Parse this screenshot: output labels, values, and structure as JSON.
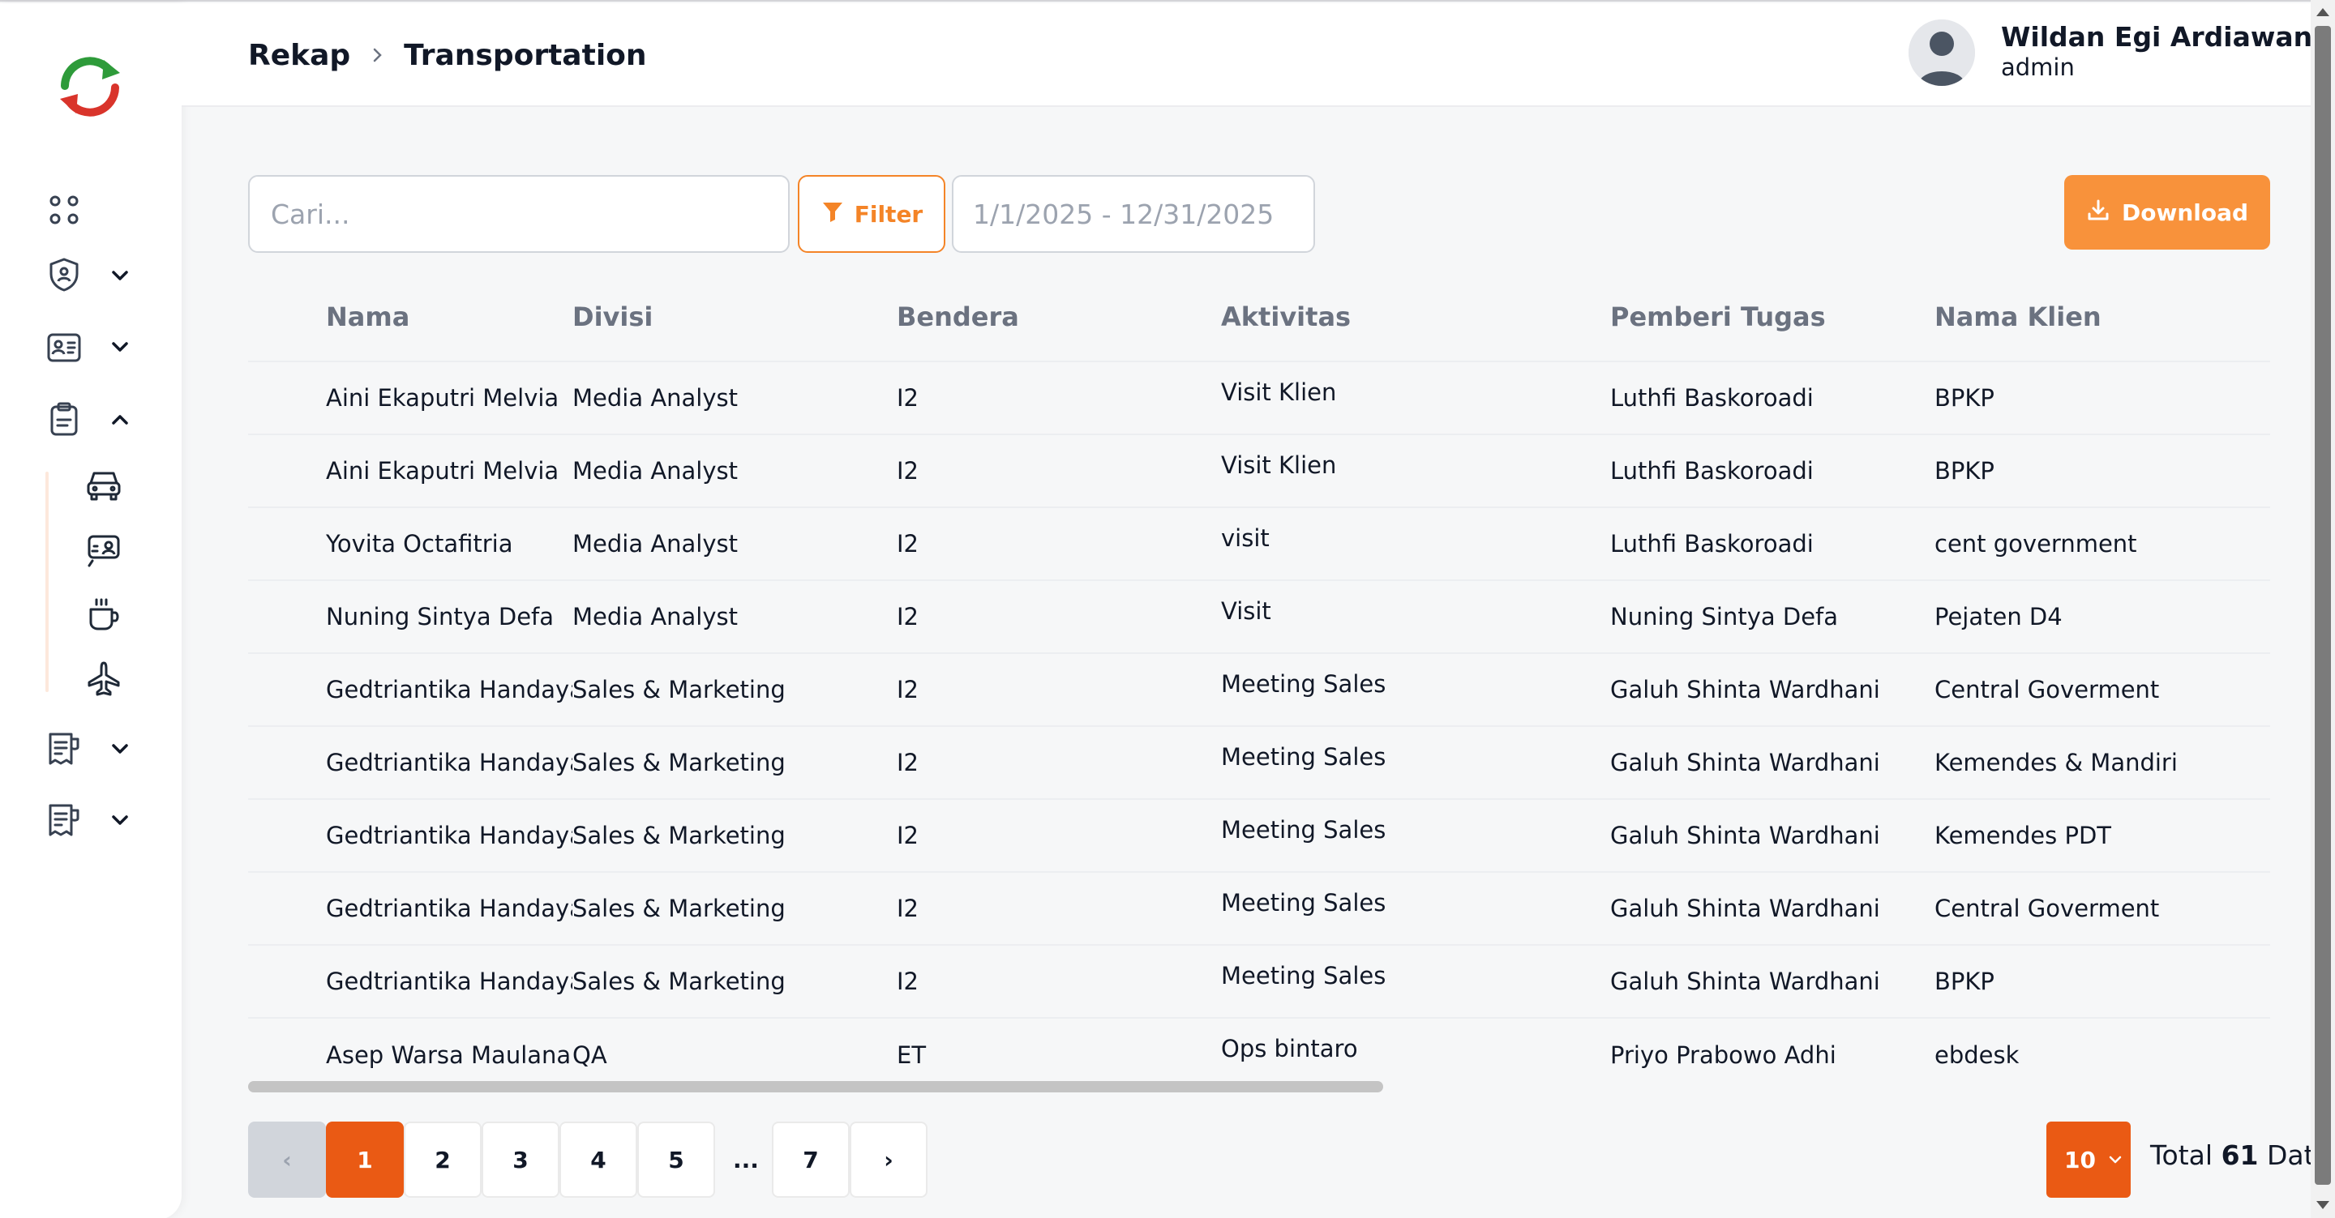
{
  "breadcrumb": {
    "parent": "Rekap",
    "current": "Transportation"
  },
  "user": {
    "name": "Wildan Egi Ardiawan",
    "role": "admin"
  },
  "toolbar": {
    "search_placeholder": "Cari...",
    "filter_label": "Filter",
    "date_range": "1/1/2025 - 12/31/2025",
    "download_label": "Download"
  },
  "sidebar": {
    "icons": [
      "dashboard-grid-icon",
      "shield-user-icon",
      "id-card-icon",
      "clipboard-icon",
      "car-icon",
      "id-badge-icon",
      "coffee-cup-icon",
      "airplane-icon",
      "receipt-icon",
      "receipt-icon"
    ],
    "submenu_icons": [
      "car-icon",
      "meeting-icon",
      "coffee-cup-icon",
      "airplane-icon"
    ]
  },
  "table": {
    "headers": [
      "Nama",
      "Divisi",
      "Bendera",
      "Aktivitas",
      "Pemberi Tugas",
      "Nama Klien"
    ],
    "rows": [
      [
        "Aini Ekaputri Melvia",
        "Media Analyst",
        "I2",
        "Visit Klien",
        "Luthfi Baskoroadi",
        "BPKP"
      ],
      [
        "Aini Ekaputri Melvia",
        "Media Analyst",
        "I2",
        "Visit Klien",
        "Luthfi Baskoroadi",
        "BPKP"
      ],
      [
        "Yovita Octafitria",
        "Media Analyst",
        "I2",
        "visit",
        "Luthfi Baskoroadi",
        "cent government"
      ],
      [
        "Nuning Sintya Defa",
        "Media Analyst",
        "I2",
        "Visit",
        "Nuning Sintya Defa",
        "Pejaten D4"
      ],
      [
        "Gedtriantika Handayani",
        "Sales & Marketing",
        "I2",
        "Meeting Sales",
        "Galuh Shinta Wardhani",
        "Central Goverment"
      ],
      [
        "Gedtriantika Handayani",
        "Sales & Marketing",
        "I2",
        "Meeting Sales",
        "Galuh Shinta Wardhani",
        "Kemendes & Mandiri"
      ],
      [
        "Gedtriantika Handayani",
        "Sales & Marketing",
        "I2",
        "Meeting Sales",
        "Galuh Shinta Wardhani",
        "Kemendes PDT"
      ],
      [
        "Gedtriantika Handayani",
        "Sales & Marketing",
        "I2",
        "Meeting Sales",
        "Galuh Shinta Wardhani",
        "Central Goverment"
      ],
      [
        "Gedtriantika Handayani",
        "Sales & Marketing",
        "I2",
        "Meeting Sales",
        "Galuh Shinta Wardhani",
        "BPKP"
      ],
      [
        "Asep Warsa Maulana",
        "QA",
        "ET",
        "Ops bintaro",
        "Priyo Prabowo Adhi",
        "ebdesk"
      ]
    ]
  },
  "pagination": {
    "prev": "‹",
    "pages": [
      "1",
      "2",
      "3",
      "4",
      "5"
    ],
    "ellipsis": "...",
    "last": "7",
    "next": "›",
    "current": "1"
  },
  "page_size": "10",
  "total": {
    "prefix": "Total",
    "count": "61",
    "suffix": "Data"
  },
  "colors": {
    "accent": "#f8923b",
    "active_page": "#ea5a14"
  }
}
